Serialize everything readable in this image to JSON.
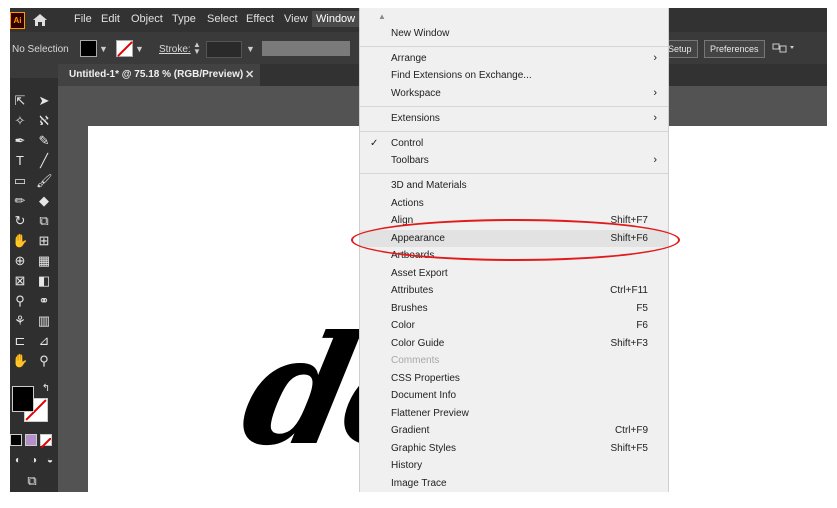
{
  "app": {
    "logo_text": "Ai"
  },
  "menubar": {
    "items": [
      "File",
      "Edit",
      "Object",
      "Type",
      "Select",
      "Effect",
      "View",
      "Window"
    ],
    "active": "Window"
  },
  "control_bar": {
    "selection_status": "No Selection",
    "stroke_label": "Stroke:",
    "setup_label": "Setup",
    "preferences_label": "Preferences"
  },
  "document_tab": {
    "title": "Untitled-1* @ 75.18 % (RGB/Preview)",
    "close_glyph": "✕"
  },
  "artwork": {
    "text": "dolo"
  },
  "window_menu": {
    "scroll_up_glyph": "▲",
    "items": [
      {
        "label": "New Window",
        "shortcut": "",
        "submenu": false,
        "checked": false,
        "disabled": false
      },
      {
        "label": "Arrange",
        "shortcut": "",
        "submenu": true,
        "checked": false,
        "disabled": false
      },
      {
        "label": "Find Extensions on Exchange...",
        "shortcut": "",
        "submenu": false,
        "checked": false,
        "disabled": false
      },
      {
        "label": "Workspace",
        "shortcut": "",
        "submenu": true,
        "checked": false,
        "disabled": false
      },
      {
        "label": "Extensions",
        "shortcut": "",
        "submenu": true,
        "checked": false,
        "disabled": false
      },
      {
        "label": "Control",
        "shortcut": "",
        "submenu": false,
        "checked": true,
        "disabled": false
      },
      {
        "label": "Toolbars",
        "shortcut": "",
        "submenu": true,
        "checked": false,
        "disabled": false
      },
      {
        "label": "3D and Materials",
        "shortcut": "",
        "submenu": false,
        "checked": false,
        "disabled": false
      },
      {
        "label": "Actions",
        "shortcut": "",
        "submenu": false,
        "checked": false,
        "disabled": false
      },
      {
        "label": "Align",
        "shortcut": "Shift+F7",
        "submenu": false,
        "checked": false,
        "disabled": false
      },
      {
        "label": "Appearance",
        "shortcut": "Shift+F6",
        "submenu": false,
        "checked": false,
        "disabled": false,
        "highlighted": true
      },
      {
        "label": "Artboards",
        "shortcut": "",
        "submenu": false,
        "checked": false,
        "disabled": false
      },
      {
        "label": "Asset Export",
        "shortcut": "",
        "submenu": false,
        "checked": false,
        "disabled": false
      },
      {
        "label": "Attributes",
        "shortcut": "Ctrl+F11",
        "submenu": false,
        "checked": false,
        "disabled": false
      },
      {
        "label": "Brushes",
        "shortcut": "F5",
        "submenu": false,
        "checked": false,
        "disabled": false
      },
      {
        "label": "Color",
        "shortcut": "F6",
        "submenu": false,
        "checked": false,
        "disabled": false
      },
      {
        "label": "Color Guide",
        "shortcut": "Shift+F3",
        "submenu": false,
        "checked": false,
        "disabled": false
      },
      {
        "label": "Comments",
        "shortcut": "",
        "submenu": false,
        "checked": false,
        "disabled": true
      },
      {
        "label": "CSS Properties",
        "shortcut": "",
        "submenu": false,
        "checked": false,
        "disabled": false
      },
      {
        "label": "Document Info",
        "shortcut": "",
        "submenu": false,
        "checked": false,
        "disabled": false
      },
      {
        "label": "Flattener Preview",
        "shortcut": "",
        "submenu": false,
        "checked": false,
        "disabled": false
      },
      {
        "label": "Gradient",
        "shortcut": "Ctrl+F9",
        "submenu": false,
        "checked": false,
        "disabled": false
      },
      {
        "label": "Graphic Styles",
        "shortcut": "Shift+F5",
        "submenu": false,
        "checked": false,
        "disabled": false
      },
      {
        "label": "History",
        "shortcut": "",
        "submenu": false,
        "checked": false,
        "disabled": false
      },
      {
        "label": "Image Trace",
        "shortcut": "",
        "submenu": false,
        "checked": false,
        "disabled": false
      }
    ]
  },
  "colors": {
    "annotation": "#e11b1b",
    "ai_brand": "#ff9a00",
    "menu_bg": "#f0f0f0",
    "ui_dark": "#323232"
  }
}
